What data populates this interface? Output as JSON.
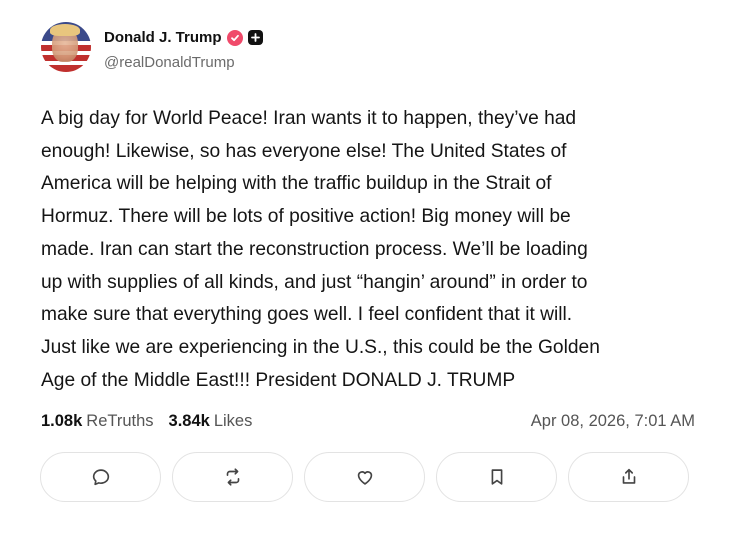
{
  "author": {
    "display_name": "Donald J. Trump",
    "handle": "@realDonaldTrump",
    "verified_icon": "verified-badge-icon",
    "plus_icon": "plus-badge-icon",
    "badge_color": "#f04a6a"
  },
  "post": {
    "text": "A big day for World Peace! Iran wants it to happen, they’ve had\nenough! Likewise, so has everyone else! The United States of\nAmerica will be helping with the traffic buildup in the Strait of\nHormuz. There will be lots of positive action! Big money will be\nmade. Iran can start the reconstruction process. We’ll be loading\nup with supplies of all kinds, and just “hangin’ around” in order to\nmake sure that everything goes well. I feel confident that it will.\nJust like we are experiencing in the U.S., this could be the Golden\nAge of the Middle East!!! President DONALD J. TRUMP"
  },
  "stats": {
    "retruths_count": "1.08k",
    "retruths_label": "ReTruths",
    "likes_count": "3.84k",
    "likes_label": "Likes",
    "timestamp": "Apr 08, 2026, 7:01 AM"
  },
  "actions": [
    {
      "name": "reply",
      "icon": "comment-icon"
    },
    {
      "name": "retruth",
      "icon": "repost-icon"
    },
    {
      "name": "like",
      "icon": "heart-icon"
    },
    {
      "name": "bookmark",
      "icon": "bookmark-icon"
    },
    {
      "name": "share",
      "icon": "share-icon"
    }
  ]
}
